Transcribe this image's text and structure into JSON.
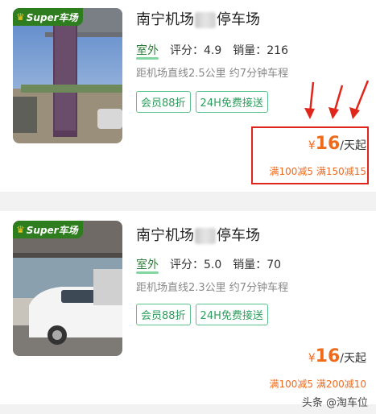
{
  "listings": [
    {
      "badge": "Super车场",
      "title_pre": "南宁机场",
      "title_post": "停车场",
      "environment": "室外",
      "rating_label": "评分：",
      "rating": "4.9",
      "sales_label": "销量：",
      "sales": "216",
      "distance": "距机场直线2.5公里 约7分钟车程",
      "tags": [
        "会员88折",
        "24H免费接送"
      ],
      "currency": "¥",
      "price": "16",
      "price_unit": "/天起",
      "promo": "满100减5 满150减15"
    },
    {
      "badge": "Super车场",
      "title_pre": "南宁机场",
      "title_post": "停车场",
      "environment": "室外",
      "rating_label": "评分：",
      "rating": "5.0",
      "sales_label": "销量：",
      "sales": "70",
      "distance": "距机场直线2.3公里 约7分钟车程",
      "tags": [
        "会员88折",
        "24H免费接送"
      ],
      "currency": "¥",
      "price": "16",
      "price_unit": "/天起",
      "promo": "满100减5 满200减10"
    }
  ],
  "watermark": "头条 @淘车位",
  "colors": {
    "accent": "#f06a1d",
    "tag": "#2e9d5d",
    "highlight": "#e0261b",
    "badge": "#2e7d1f"
  }
}
